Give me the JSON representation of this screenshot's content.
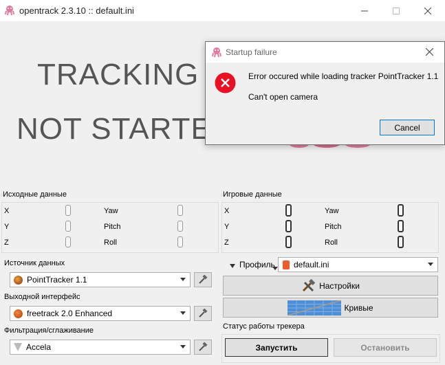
{
  "window": {
    "title": "opentrack 2.3.10 :: default.ini"
  },
  "status": {
    "line1": "TRACKING",
    "line2": "NOT STARTED"
  },
  "raw": {
    "label": "Исходные данные",
    "axes_left": [
      "X",
      "Y",
      "Z"
    ],
    "axes_right": [
      "Yaw",
      "Pitch",
      "Roll"
    ]
  },
  "game": {
    "label": "Игровые данные",
    "axes_left": [
      "X",
      "Y",
      "Z"
    ],
    "axes_right": [
      "Yaw",
      "Pitch",
      "Roll"
    ]
  },
  "source": {
    "label": "Источник данных",
    "value": "PointTracker 1.1"
  },
  "output": {
    "label": "Выходной интерфейс",
    "value": "freetrack 2.0 Enhanced"
  },
  "filter": {
    "label": "Фильтрация/сглаживание",
    "value": "Accela"
  },
  "profile": {
    "label": "Профиль",
    "value": "default.ini"
  },
  "settings_button": "Настройки",
  "curves_button": "Кривые",
  "tracker_status": {
    "label": "Статус работы трекера",
    "start": "Запустить",
    "stop": "Остановить"
  },
  "dialog": {
    "title": "Startup failure",
    "message": "Error occured while loading tracker PointTracker 1.1",
    "detail": "Can't open camera",
    "cancel": "Cancel"
  },
  "colors": {
    "error": "#e81123",
    "octopus": "#e27a9b",
    "accent": "#0078d7"
  }
}
